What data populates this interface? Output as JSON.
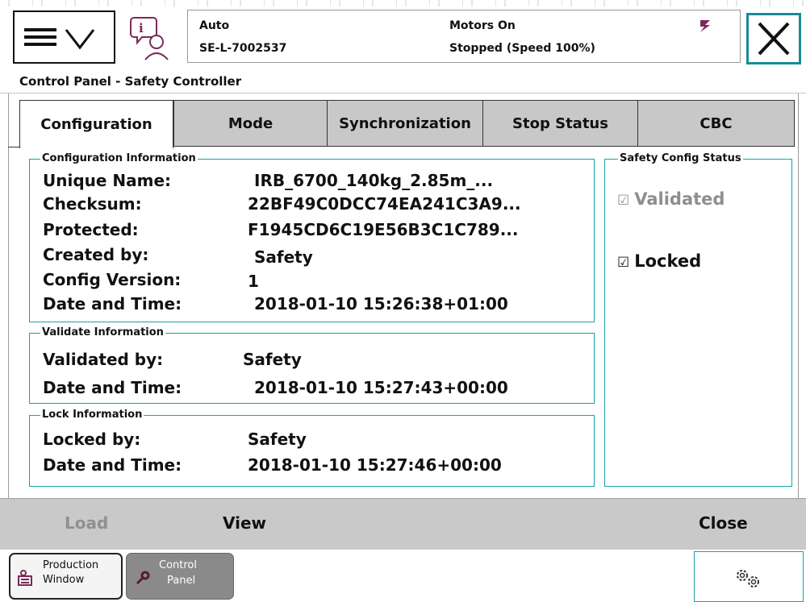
{
  "status": {
    "mode": "Auto",
    "system_name": "SE-L-7002537",
    "motors": "Motors On",
    "run_state": "Stopped (Speed 100%)"
  },
  "window_title": "Control Panel - Safety Controller",
  "tabs": [
    {
      "label": "Configuration",
      "active": true
    },
    {
      "label": "Mode",
      "active": false
    },
    {
      "label": "Synchronization",
      "active": false
    },
    {
      "label": "Stop Status",
      "active": false
    },
    {
      "label": "CBC",
      "active": false
    }
  ],
  "config_info": {
    "legend": "Configuration Information",
    "rows": [
      {
        "label": "Unique Name:",
        "value": "IRB_6700_140kg_2.85m_..."
      },
      {
        "label": "Checksum:",
        "value": "22BF49C0DCC74EA241C3A9..."
      },
      {
        "label": "Protected:",
        "value": "F1945CD6C19E56B3C1C789..."
      },
      {
        "label": "Created by:",
        "value": "Safety"
      },
      {
        "label": "Config Version:",
        "value": "1"
      },
      {
        "label": "Date and Time:",
        "value": "2018-01-10 15:26:38+01:00"
      }
    ]
  },
  "validate_info": {
    "legend": "Validate Information",
    "rows": [
      {
        "label": "Validated by:",
        "value": "Safety"
      },
      {
        "label": "Date and Time:",
        "value": "2018-01-10 15:27:43+00:00"
      }
    ]
  },
  "lock_info": {
    "legend": "Lock Information",
    "rows": [
      {
        "label": "Locked by:",
        "value": "Safety"
      },
      {
        "label": "Date and Time:",
        "value": "2018-01-10 15:27:46+00:00"
      }
    ]
  },
  "safety_status": {
    "legend": "Safety Config Status",
    "validated": {
      "label": "Validated",
      "checked": true,
      "enabled": false
    },
    "locked": {
      "label": "Locked",
      "checked": true,
      "enabled": true
    },
    "check_glyph": "☑"
  },
  "commands": {
    "load": "Load",
    "view": "View",
    "close": "Close"
  },
  "taskbar": {
    "production": {
      "line1": "Production",
      "line2": "Window"
    },
    "control": {
      "line1": "Control",
      "line2": "Panel"
    }
  },
  "icons": {
    "menu": "menu-icon",
    "info": "event-log-icon",
    "close": "close-icon",
    "settings": "quickset-icon",
    "speed": "speed-icon"
  },
  "colors": {
    "accent": "#1aa0aa",
    "tab_inactive": "#c8c8c8",
    "cmdbar": "#c9c9c9",
    "disabled_text": "#909090"
  }
}
